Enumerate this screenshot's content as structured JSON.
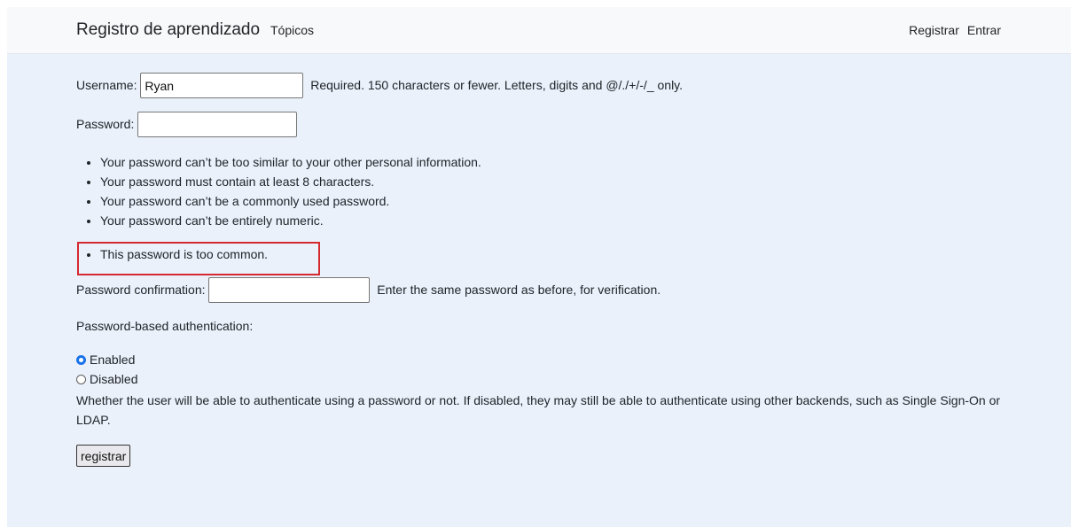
{
  "navbar": {
    "brand": "Registro de aprendizado",
    "topics": "Tópicos",
    "register": "Registrar",
    "login": "Entrar"
  },
  "form": {
    "username": {
      "label": "Username:",
      "value": "Ryan",
      "help": "Required. 150 characters or fewer. Letters, digits and @/./+/-/_ only."
    },
    "password": {
      "label": "Password:",
      "value": "",
      "rules": [
        "Your password can’t be too similar to your other personal information.",
        "Your password must contain at least 8 characters.",
        "Your password can’t be a commonly used password.",
        "Your password can’t be entirely numeric."
      ]
    },
    "errors": [
      "This password is too common."
    ],
    "password_confirmation": {
      "label": "Password confirmation:",
      "value": "",
      "help": "Enter the same password as before, for verification."
    },
    "auth": {
      "label": "Password-based authentication:",
      "options": [
        {
          "label": "Enabled",
          "checked": true
        },
        {
          "label": "Disabled",
          "checked": false
        }
      ],
      "help": "Whether the user will be able to authenticate using a password or not. If disabled, they may still be able to authenticate using other backends, such as Single Sign-On or LDAP."
    },
    "submit_label": "registrar"
  },
  "colors": {
    "page_background": "#eaf1fb",
    "navbar_background": "#f8f9fa",
    "error_highlight": "#d42a2f",
    "radio_accent": "#1a73e8"
  }
}
